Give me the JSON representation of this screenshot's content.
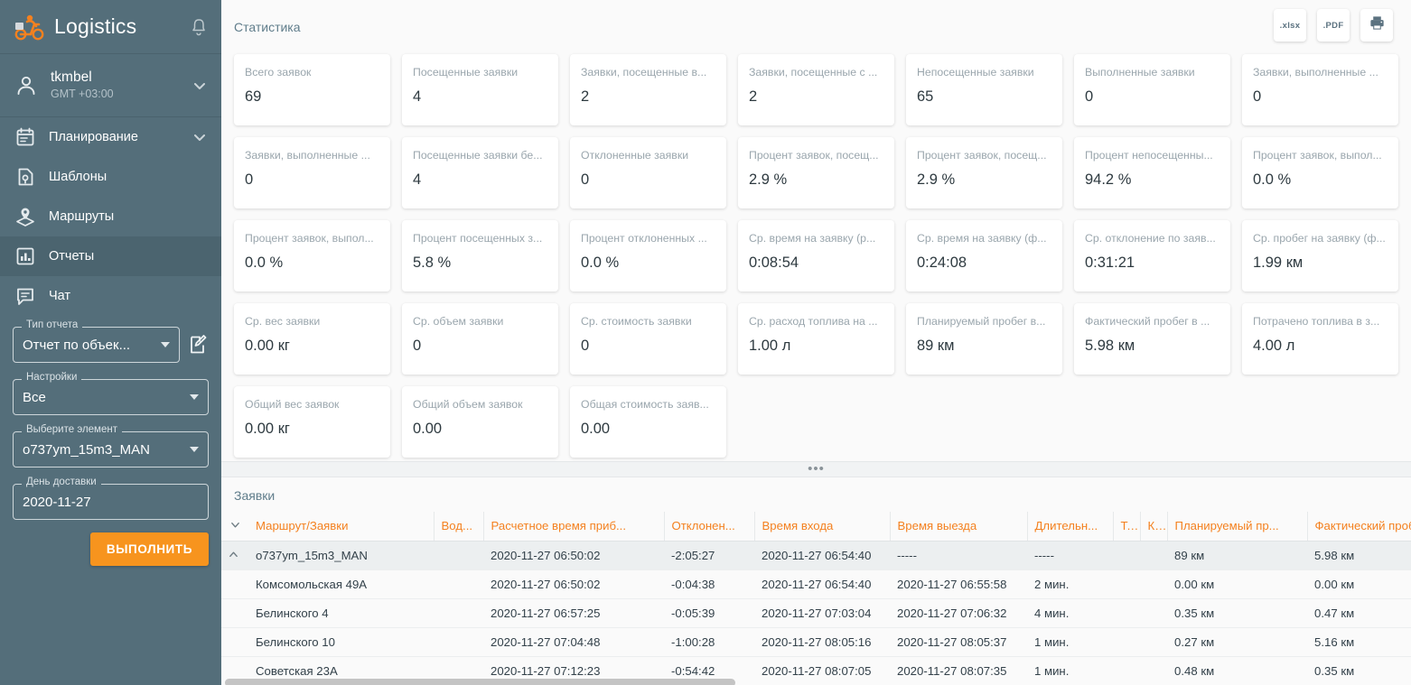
{
  "brand": {
    "title": "Logistics",
    "logo_icon": "scooter-courier-icon",
    "bell_icon": "bell-icon"
  },
  "user": {
    "name": "tkmbel",
    "timezone": "GMT +03:00",
    "icon": "person-icon",
    "chevron_icon": "chevron-down-icon"
  },
  "nav": [
    {
      "label": "Планирование",
      "icon": "calendar-icon",
      "active": false,
      "expandable": true
    },
    {
      "label": "Шаблоны",
      "icon": "template-icon",
      "active": false,
      "expandable": false
    },
    {
      "label": "Маршруты",
      "icon": "route-pin-icon",
      "active": false,
      "expandable": false
    },
    {
      "label": "Отчеты",
      "icon": "bar-chart-icon",
      "active": true,
      "expandable": false
    },
    {
      "label": "Чат",
      "icon": "chat-icon",
      "active": false,
      "expandable": false
    }
  ],
  "controls": {
    "report_type": {
      "legend": "Тип отчета",
      "value": "Отчет по объек..."
    },
    "edit_icon": "edit-document-icon",
    "settings": {
      "legend": "Настройки",
      "value": "Все"
    },
    "element": {
      "legend": "Выберите элемент",
      "value": "o737ym_15m3_MAN"
    },
    "delivery_day": {
      "legend": "День доставки",
      "value": "2020-11-27"
    },
    "run_button": "ВЫПОЛНИТЬ",
    "accent_color": "#f7941e"
  },
  "stats": {
    "title": "Статистика",
    "exports": [
      {
        "label": ".xlsx",
        "icon": "xlsx-export-icon"
      },
      {
        "label": ".PDF",
        "icon": "pdf-export-icon"
      },
      {
        "label": "",
        "icon": "printer-icon"
      }
    ],
    "cards": [
      {
        "label": "Всего заявок",
        "value": "69"
      },
      {
        "label": "Посещенные заявки",
        "value": "4"
      },
      {
        "label": "Заявки, посещенные в...",
        "value": "2"
      },
      {
        "label": "Заявки, посещенные с ...",
        "value": "2"
      },
      {
        "label": "Непосещенные заявки",
        "value": "65"
      },
      {
        "label": "Выполненные заявки",
        "value": "0"
      },
      {
        "label": "Заявки, выполненные ...",
        "value": "0"
      },
      {
        "label": "Заявки, выполненные ...",
        "value": "0"
      },
      {
        "label": "Посещенные заявки бе...",
        "value": "4"
      },
      {
        "label": "Отклоненные заявки",
        "value": "0"
      },
      {
        "label": "Процент заявок, посещ...",
        "value": "2.9 %"
      },
      {
        "label": "Процент заявок, посещ...",
        "value": "2.9 %"
      },
      {
        "label": "Процент непосещенны...",
        "value": "94.2 %"
      },
      {
        "label": "Процент заявок, выпол...",
        "value": "0.0 %"
      },
      {
        "label": "Процент заявок, выпол...",
        "value": "0.0 %"
      },
      {
        "label": "Процент посещенных з...",
        "value": "5.8 %"
      },
      {
        "label": "Процент отклоненных ...",
        "value": "0.0 %"
      },
      {
        "label": "Ср. время на заявку (р...",
        "value": "0:08:54"
      },
      {
        "label": "Ср. время на заявку (ф...",
        "value": "0:24:08"
      },
      {
        "label": "Ср. отклонение по заяв...",
        "value": "0:31:21"
      },
      {
        "label": "Ср. пробег на заявку (ф...",
        "value": "1.99 км"
      },
      {
        "label": "Ср. вес заявки",
        "value": "0.00 кг"
      },
      {
        "label": "Ср. объем заявки",
        "value": "0"
      },
      {
        "label": "Ср. стоимость заявки",
        "value": "0"
      },
      {
        "label": "Ср. расход топлива на ...",
        "value": "1.00 л"
      },
      {
        "label": "Планируемый пробег в...",
        "value": "89 км"
      },
      {
        "label": "Фактический пробег в ...",
        "value": "5.98 км"
      },
      {
        "label": "Потрачено топлива в з...",
        "value": "4.00 л"
      },
      {
        "label": "Общий вес заявок",
        "value": "0.00 кг"
      },
      {
        "label": "Общий объем заявок",
        "value": "0.00"
      },
      {
        "label": "Общая стоимость заяв...",
        "value": "0.00"
      }
    ]
  },
  "splitter": {
    "handle": "•••"
  },
  "orders": {
    "title": "Заявки",
    "columns": [
      "Маршрут/Заявки",
      "Вод...",
      "Расчетное время приб...",
      "Отклонен...",
      "Время входа",
      "Время выезда",
      "Длительн...",
      "Т...",
      "К...",
      "Планируемый пр...",
      "Фактический пробег"
    ],
    "rows": [
      {
        "parent": true,
        "name": "o737ym_15m3_MAN",
        "driver": "",
        "eta": "2020-11-27 06:50:02",
        "deviation": "-2:05:27",
        "entry": "2020-11-27 06:54:40",
        "exit": "-----",
        "duration": "-----",
        "t": "",
        "k": "",
        "planned": "89 км",
        "actual": "5.98 км"
      },
      {
        "parent": false,
        "name": "Комсомольская 49А",
        "driver": "",
        "eta": "2020-11-27 06:50:02",
        "deviation": "-0:04:38",
        "entry": "2020-11-27 06:54:40",
        "exit": "2020-11-27 06:55:58",
        "duration": "2 мин.",
        "t": "",
        "k": "",
        "planned": "0.00 км",
        "actual": "0.00 км"
      },
      {
        "parent": false,
        "name": "Белинского 4",
        "driver": "",
        "eta": "2020-11-27 06:57:25",
        "deviation": "-0:05:39",
        "entry": "2020-11-27 07:03:04",
        "exit": "2020-11-27 07:06:32",
        "duration": "4 мин.",
        "t": "",
        "k": "",
        "planned": "0.35 км",
        "actual": "0.47 км"
      },
      {
        "parent": false,
        "name": "Белинского 10",
        "driver": "",
        "eta": "2020-11-27 07:04:48",
        "deviation": "-1:00:28",
        "entry": "2020-11-27 08:05:16",
        "exit": "2020-11-27 08:05:37",
        "duration": "1 мин.",
        "t": "",
        "k": "",
        "planned": "0.27 км",
        "actual": "5.16 км"
      },
      {
        "parent": false,
        "name": "Советская 23А",
        "driver": "",
        "eta": "2020-11-27 07:12:23",
        "deviation": "-0:54:42",
        "entry": "2020-11-27 08:07:05",
        "exit": "2020-11-27 08:07:35",
        "duration": "1 мин.",
        "t": "",
        "k": "",
        "planned": "0.48 км",
        "actual": "0.35 км"
      }
    ]
  }
}
